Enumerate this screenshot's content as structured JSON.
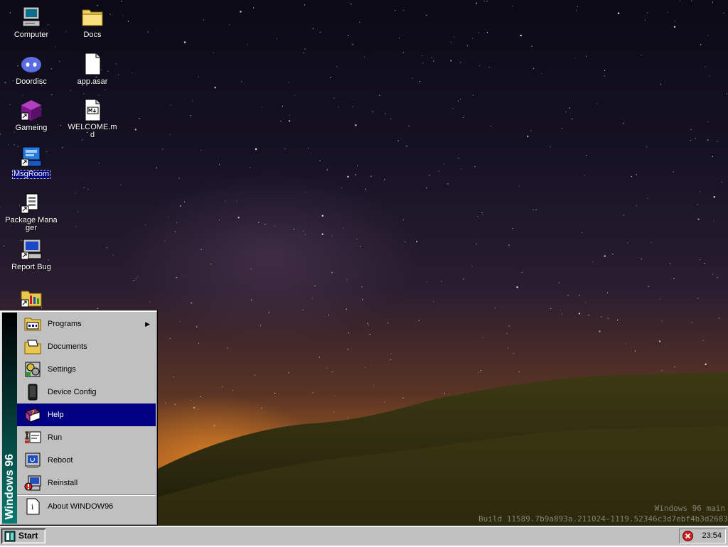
{
  "desktop": {
    "icons": [
      {
        "label": "Computer"
      },
      {
        "label": "Doordisc"
      },
      {
        "label": "Gameing"
      },
      {
        "label": "MsgRoom"
      },
      {
        "label": "Package Manager"
      },
      {
        "label": "Report Bug"
      },
      {
        "label": ""
      },
      {
        "label": "Docs"
      },
      {
        "label": "app.asar"
      },
      {
        "label": "WELCOME.md"
      }
    ],
    "selected_icon": "MsgRoom",
    "watermark_line1": "Windows 96 main",
    "watermark_line2": "Build 11589.7b9a893a.211024-1119.52346c3d7ebf4b3d2683"
  },
  "start_menu": {
    "sidebar_text": "Windows 96",
    "items": [
      {
        "label": "Programs",
        "icon": "programs-icon",
        "submenu": true
      },
      {
        "label": "Documents",
        "icon": "documents-icon"
      },
      {
        "label": "Settings",
        "icon": "settings-icon"
      },
      {
        "label": "Device Config",
        "icon": "device-icon"
      },
      {
        "label": "Help",
        "icon": "help-icon"
      },
      {
        "label": "Run",
        "icon": "run-icon"
      },
      {
        "label": "Reboot",
        "icon": "reboot-icon"
      },
      {
        "label": "Reinstall",
        "icon": "reinstall-icon"
      },
      {
        "label": "About WINDOW96",
        "icon": "about-icon"
      }
    ],
    "active_item": "Help",
    "submenu_arrow": "▶"
  },
  "taskbar": {
    "start_label": "Start",
    "clock": "23:54"
  },
  "colors": {
    "selection": "#000080",
    "face": "#c0c0c0"
  }
}
